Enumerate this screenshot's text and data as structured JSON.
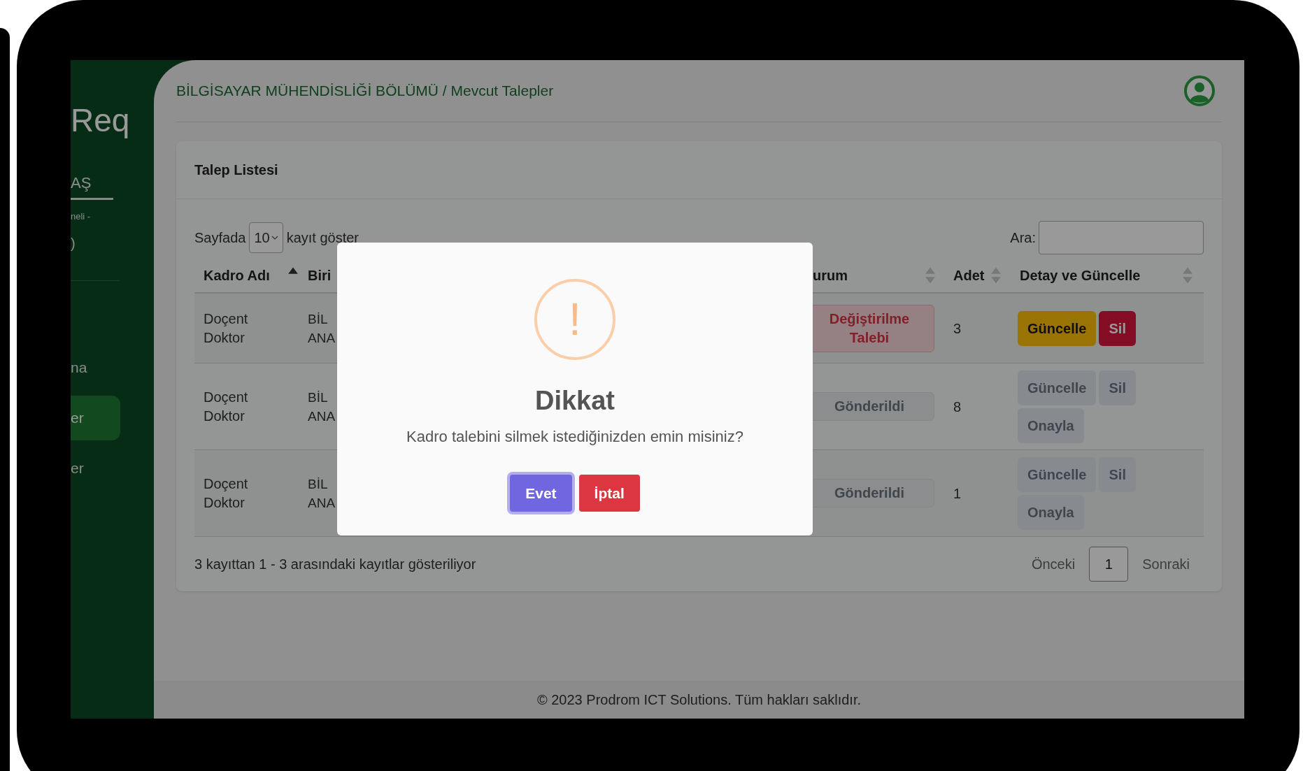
{
  "sidebar": {
    "logo": "Req",
    "user": "AŞ",
    "subtitle": "neli -",
    "note": ")",
    "items": [
      {
        "label": "na",
        "selected": false
      },
      {
        "label": "er",
        "selected": true
      },
      {
        "label": "er",
        "selected": false
      }
    ]
  },
  "header": {
    "breadcrumb": "BİLGİSAYAR MÜHENDİSLİĞİ BÖLÜMÜ / Mevcut Talepler"
  },
  "card": {
    "title": "Talep Listesi",
    "length_prefix": "Sayfada",
    "length_value": "10",
    "length_suffix": "kayıt göster",
    "search_label": "Ara:",
    "table": {
      "columns": [
        {
          "label": "Kadro Adı",
          "sortable": true,
          "sorted_ascending": true
        },
        {
          "label": "Biri"
        },
        {
          "label": "urum",
          "sortable": true,
          "sorted_ascending": false
        },
        {
          "label": "Adet",
          "sortable": true,
          "sorted_ascending": false
        },
        {
          "label": "Detay ve Güncelle",
          "sortable": true,
          "sorted_ascending": false
        }
      ],
      "rows": [
        {
          "kadro": "Doçent Doktor",
          "birim": [
            "BİL",
            "ANA"
          ],
          "status": {
            "label": "Değiştirilme Talebi",
            "kind": "change"
          },
          "adet": "3",
          "actions": [
            {
              "label": "Güncelle",
              "kind": "update",
              "disabled": false
            },
            {
              "label": "Sil",
              "kind": "delete",
              "disabled": false
            }
          ]
        },
        {
          "kadro": "Doçent Doktor",
          "birim": [
            "BİL",
            "ANA"
          ],
          "status": {
            "label": "Gönderildi",
            "kind": "sent"
          },
          "adet": "8",
          "actions": [
            {
              "label": "Güncelle",
              "kind": "update",
              "disabled": true
            },
            {
              "label": "Sil",
              "kind": "delete",
              "disabled": true
            },
            {
              "label": "Onayla",
              "kind": "approve",
              "disabled": true
            }
          ]
        },
        {
          "kadro": "Doçent Doktor",
          "birim": [
            "BİL",
            "ANA"
          ],
          "status": {
            "label": "Gönderildi",
            "kind": "sent"
          },
          "adet": "1",
          "actions": [
            {
              "label": "Güncelle",
              "kind": "update",
              "disabled": true
            },
            {
              "label": "Sil",
              "kind": "delete",
              "disabled": true
            },
            {
              "label": "Onayla",
              "kind": "approve",
              "disabled": true
            }
          ]
        }
      ]
    },
    "info": "3 kayıttan 1 - 3 arasındaki kayıtlar gösteriliyor",
    "pagination": [
      {
        "label": "Önceki",
        "selected": false
      },
      {
        "label": "1",
        "selected": true
      },
      {
        "label": "Sonraki",
        "selected": false
      }
    ]
  },
  "footer": "© 2023 Prodrom ICT Solutions. Tüm hakları saklıdır.",
  "modal": {
    "icon_symbol": "!",
    "title": "Dikkat",
    "message": "Kadro talebini silmek istediğinizden emin misiniz?",
    "buttons": [
      {
        "label": "Evet",
        "kind": "confirm",
        "focused": true
      },
      {
        "label": "İptal",
        "kind": "cancel",
        "focused": false
      }
    ]
  }
}
